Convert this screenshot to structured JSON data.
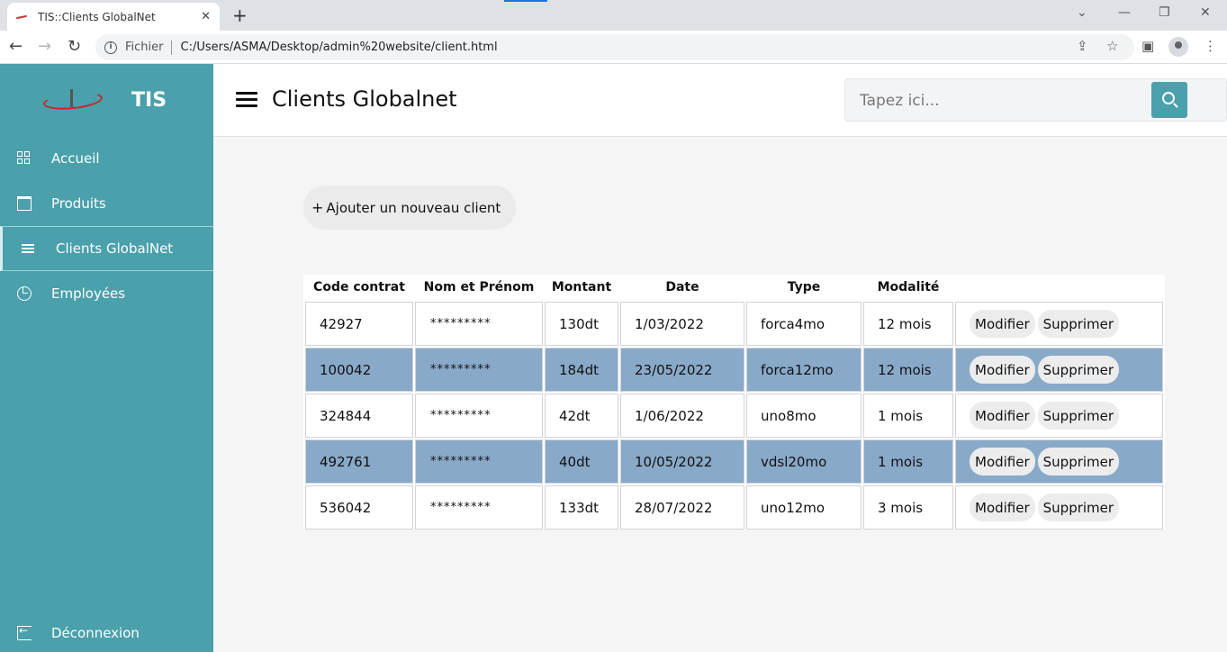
{
  "browser": {
    "tab_title": "TIS::Clients GlobalNet",
    "tab_close": "✕",
    "new_tab": "+",
    "scheme_label": "Fichier",
    "url": "C:/Users/ASMA/Desktop/admin%20website/client.html",
    "window_controls": [
      "⌄",
      "—",
      "❐",
      "✕"
    ]
  },
  "sidebar": {
    "brand": "TIS",
    "items": [
      {
        "label": "Accueil",
        "icon": "grid-icon"
      },
      {
        "label": "Produits",
        "icon": "archive-icon"
      },
      {
        "label": "Clients GlobalNet",
        "icon": "list-icon",
        "active": true
      },
      {
        "label": "Employées",
        "icon": "pie-chart-icon"
      }
    ],
    "logout_label": "Déconnexion"
  },
  "header": {
    "title": "Clients Globalnet",
    "search_placeholder": "Tapez ici..."
  },
  "main": {
    "add_label": "Ajouter un nouveau client",
    "columns": [
      "Code contrat",
      "Nom et Prénom",
      "Montant",
      "Date",
      "Type",
      "Modalité",
      ""
    ],
    "rows": [
      {
        "code": "42927",
        "name": "*********",
        "amount": "130dt",
        "date": "1/03/2022",
        "type": "forca4mo",
        "modality": "12 mois"
      },
      {
        "code": "100042",
        "name": "*********",
        "amount": "184dt",
        "date": "23/05/2022",
        "type": "forca12mo",
        "modality": "12 mois"
      },
      {
        "code": "324844",
        "name": "*********",
        "amount": "42dt",
        "date": "1/06/2022",
        "type": "uno8mo",
        "modality": "1 mois"
      },
      {
        "code": "492761",
        "name": "*********",
        "amount": "40dt",
        "date": "10/05/2022",
        "type": "vdsl20mo",
        "modality": "1 mois"
      },
      {
        "code": "536042",
        "name": "*********",
        "amount": "133dt",
        "date": "28/07/2022",
        "type": "uno12mo",
        "modality": "3 mois"
      }
    ],
    "edit_label": "Modifier",
    "delete_label": "Supprimer"
  },
  "colors": {
    "sidebar": "#4aa0ab",
    "row_highlight": "#89a9c9",
    "search_button": "#4aa0ab"
  }
}
